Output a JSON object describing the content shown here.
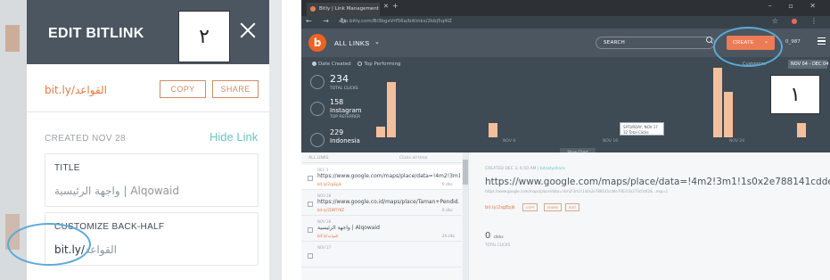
{
  "edit_panel": {
    "title": "EDIT BITLINK",
    "short_link": "bit.ly/القواعد",
    "copy_label": "COPY",
    "share_label": "SHARE",
    "created": "CREATED NOV 28",
    "hide_link": "Hide Link",
    "title_label": "TITLE",
    "title_value": "واجهة الرئيسية | Alqowaid",
    "customize_label": "CUSTOMIZE BACK-HALF",
    "backhalf_prefix": "bit.ly/",
    "backhalf_value": "القواعد",
    "annotation": "٢"
  },
  "browser": {
    "tab_title": "Bitly | Link Management",
    "url": "app.bitly.com/Bi3bgxVrf56a/bitlinks/2kbj5q4lZ",
    "app": {
      "all_links": "ALL LINKS",
      "search_placeholder": "SEARCH",
      "create_label": "CREATE",
      "user": "0_987"
    },
    "annotation": "١"
  },
  "dashboard": {
    "filter_date": "Date Created",
    "filter_top": "Top Performing",
    "customize": "Customize",
    "date_range": "NOV 04 - DEC 04",
    "stats": [
      {
        "value": "234",
        "label": "TOTAL CLICKS"
      },
      {
        "value": "158",
        "sub": "Instagram",
        "label": "TOP REFERRER"
      },
      {
        "value": "229",
        "sub": "Indonesia",
        "label": "TOP LOCATION"
      }
    ],
    "x_ticks": [
      "NOV 8",
      "NOV 16",
      "NOV 24",
      "DEC 1"
    ],
    "tooltip": "SATURDAY, NOV 17\n32 Total Clicks",
    "show_chart": "Show Chart"
  },
  "chart_data": {
    "type": "bar",
    "categories": [
      "NOV 15",
      "NOV 17",
      "NOV 27",
      "NOV 28",
      "NOV 29",
      "DEC 3"
    ],
    "values": [
      3,
      16,
      4,
      20,
      13,
      4
    ],
    "title": "",
    "xlabel": "",
    "ylabel": ""
  },
  "list": {
    "header_left": "ALL LINKS",
    "header_right": "Clicks all time",
    "items": [
      {
        "date": "DEC 3",
        "title": "https://www.google.com/maps/place/data=!4m2!3m1!1...",
        "link": "bit.ly/2sgEpjk",
        "clicks": "0 clks"
      },
      {
        "date": "NOV 28",
        "title": "https://www.google.co.id/maps/place/Taman+Pendid...",
        "link": "bit.ly/2DNTY8Z",
        "clicks": "0 clks"
      },
      {
        "date": "NOV 28",
        "title": "واجهة الرئيسية | Alqowaid",
        "link": "bit.ly/القواعد",
        "clicks": "24 clks"
      },
      {
        "date": "NOV 27",
        "title": "",
        "link": "",
        "clicks": ""
      }
    ]
  },
  "detail": {
    "created_prefix": "CREATED DEC 3, 6:50 AM | ",
    "created_user": "bitsatyshare",
    "title": "https://www.google.com/maps/place/data=!4m2!3m1!1s0x2e788141cdde7463:0x273c0c82...",
    "long_url": "https://www.google.com/maps/place/data=!4m2!3m1!1s0x2e788141cdde7463:0x273c0c82&...exp=1",
    "short_link": "bit.ly/2sgEpjk",
    "copy": "COPY",
    "share": "SHARE",
    "edit": "EDIT",
    "clicks_value": "0",
    "clicks_unit": "clicks",
    "clicks_label": "TOTAL CLICKS"
  }
}
